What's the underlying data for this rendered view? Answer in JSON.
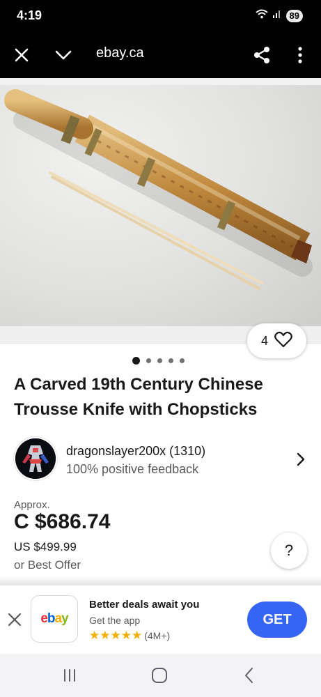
{
  "status_bar": {
    "time": "4:19",
    "battery": "89"
  },
  "browser": {
    "url": "ebay.ca"
  },
  "gallery": {
    "favorites_count": "4",
    "image_count": 5,
    "active_index": 0
  },
  "item": {
    "title": "A Carved 19th Century Chinese Trousse Knife with Chopsticks"
  },
  "seller": {
    "name": "dragonslayer200x (1310)",
    "feedback": "100% positive feedback"
  },
  "pricing": {
    "approx_label": "Approx.",
    "price": "C $686.74",
    "us_price": "US $499.99",
    "offer_text": "or Best Offer"
  },
  "help": {
    "label": "?"
  },
  "app_banner": {
    "logo": [
      "e",
      "b",
      "a",
      "y"
    ],
    "title": "Better deals await you",
    "subtitle": "Get the app",
    "stars": "★★★★★",
    "rating_count": "(4M+)",
    "cta": "GET"
  },
  "colors": {
    "accent": "#3665f3",
    "bar": "#000000",
    "star": "#f5af02"
  }
}
